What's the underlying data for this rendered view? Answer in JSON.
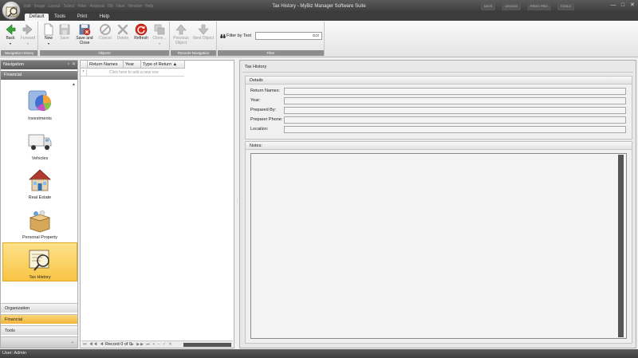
{
  "window": {
    "title": "Tax History - MyBiz Manager Software Suite",
    "qat_items": [
      "Edit",
      "Image",
      "Layout",
      "Select",
      "Filter",
      "Analysis",
      "Db",
      "View",
      "Window",
      "Help"
    ],
    "title_right": [
      "DAYS",
      "DESIGN",
      "PRINT PRG",
      "TOOLS"
    ],
    "controls": {
      "minimize": "—",
      "maximize": "□",
      "close": "✕"
    }
  },
  "ribbon": {
    "tabs": [
      {
        "label": "Default",
        "active": true
      },
      {
        "label": "Tools",
        "active": false
      },
      {
        "label": "Print",
        "active": false
      },
      {
        "label": "Help",
        "active": false
      }
    ],
    "groups": {
      "navigation_history": {
        "label": "Navigation History",
        "back": "Back",
        "forward": "Forward"
      },
      "objects": {
        "label": "Objects",
        "new": "New",
        "save": "Save",
        "save_and_close_line1": "Save and",
        "save_and_close_line2": "Close",
        "cancel": "Cancel",
        "delete": "Delete",
        "refresh": "Refresh",
        "clone": "Clone..."
      },
      "records_navigation": {
        "label": "Records Navigation",
        "previous_line1": "Previous",
        "previous_line2": "Object",
        "next": "Next Object"
      },
      "filter": {
        "label": "Filter",
        "filter_by_text": "Filter by Text",
        "go": "GO!"
      }
    }
  },
  "navigation": {
    "header": "Navigation",
    "pin": "ᵖ",
    "close": "✕",
    "section": "Financial",
    "items": [
      {
        "label": "Investments",
        "selected": false
      },
      {
        "label": "Vehicles",
        "selected": false
      },
      {
        "label": "Real Estate",
        "selected": false
      },
      {
        "label": "Personal Property",
        "selected": false
      },
      {
        "label": "Tax History",
        "selected": true
      }
    ],
    "groups": [
      {
        "label": "Organization",
        "active": false
      },
      {
        "label": "Financial",
        "active": true
      },
      {
        "label": "Tools",
        "active": false
      }
    ]
  },
  "grid": {
    "columns": [
      "Return Names",
      "Year",
      "Type of Return ▲"
    ],
    "new_row_marker": "*",
    "new_row_text": "Click here to add a new row",
    "record_text": "Record 0 of 0"
  },
  "detail": {
    "title": "Tax History",
    "details_header": "Details",
    "fields": [
      {
        "label": "Return Names:",
        "value": ""
      },
      {
        "label": "Year:",
        "value": ""
      },
      {
        "label": "Prepared By:",
        "value": ""
      },
      {
        "label": "Preparer Phone:",
        "value": ""
      },
      {
        "label": "Location:",
        "value": ""
      }
    ],
    "notes_header": "Notes:",
    "notes_value": ""
  },
  "status": {
    "user": "User: Admin"
  }
}
